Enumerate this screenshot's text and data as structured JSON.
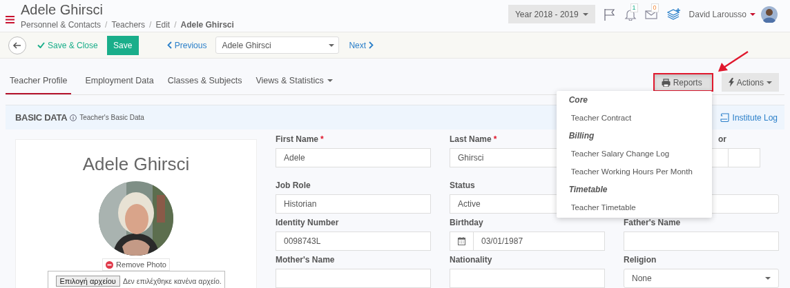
{
  "header": {
    "title": "Adele Ghirsci",
    "separator": "/",
    "breadcrumb": [
      {
        "label": "Personnel & Contacts",
        "current": false
      },
      {
        "label": "Teachers",
        "current": false
      },
      {
        "label": "Edit",
        "current": false
      },
      {
        "label": "Adele Ghirsci",
        "current": true
      }
    ],
    "year": "Year 2018 - 2019",
    "notifications": "1",
    "messages": "0",
    "user": "David Larousso"
  },
  "toolbar": {
    "save_close": "Save & Close",
    "save": "Save",
    "previous": "Previous",
    "record": "Adele Ghirsci",
    "next": "Next"
  },
  "tabs": [
    {
      "label": "Teacher Profile",
      "selected": true,
      "dropdown": false
    },
    {
      "label": "Employment Data",
      "selected": false,
      "dropdown": false
    },
    {
      "label": "Classes & Subjects",
      "selected": false,
      "dropdown": false
    },
    {
      "label": "Views & Statistics",
      "selected": false,
      "dropdown": true
    }
  ],
  "actions": [
    {
      "label": "Reports",
      "kind": "reports",
      "highlighted": true,
      "expanded": true
    },
    {
      "label": "Actions",
      "kind": "actions",
      "highlighted": false,
      "expanded": false
    }
  ],
  "reports_menu": [
    {
      "heading": "Core",
      "items": [
        "Teacher Contract"
      ]
    },
    {
      "heading": "Billing",
      "items": [
        "Teacher Salary Change Log",
        "Teacher Working Hours Per Month"
      ]
    },
    {
      "heading": "Timetable",
      "items": [
        "Teacher Timetable"
      ]
    }
  ],
  "section": {
    "title": "BASIC DATA",
    "subtitle": "Teacher's Basic Data",
    "link": "Institute Log"
  },
  "profile": {
    "name": "Adele Ghirsci",
    "remove_photo": "Remove Photo",
    "file_button": "Επιλογή αρχείου",
    "file_status": "Δεν επιλέχθηκε κανένα αρχείο."
  },
  "required_marker": "*",
  "fields": [
    {
      "label": "First Name",
      "required": true,
      "kind": "text",
      "value": "Adele"
    },
    {
      "label": "Last Name",
      "required": true,
      "kind": "text",
      "value": "Ghirsci"
    },
    {
      "label": "or",
      "required": false,
      "kind": "split"
    },
    {
      "label": "Job Role",
      "required": false,
      "kind": "text",
      "value": "Historian"
    },
    {
      "label": "Status",
      "required": false,
      "kind": "text",
      "value": "Active"
    },
    {
      "required": false,
      "kind": "select"
    },
    {
      "label": "Identity Number",
      "required": false,
      "kind": "text",
      "value": "0098743L"
    },
    {
      "label": "Birthday",
      "required": false,
      "kind": "date",
      "value": "03/01/1987"
    },
    {
      "label": "Father's Name",
      "required": false,
      "kind": "text"
    },
    {
      "label": "Mother's Name",
      "required": false,
      "kind": "text"
    },
    {
      "label": "Nationality",
      "required": false,
      "kind": "text"
    },
    {
      "label": "Religion",
      "required": false,
      "kind": "select",
      "value": "None"
    }
  ]
}
